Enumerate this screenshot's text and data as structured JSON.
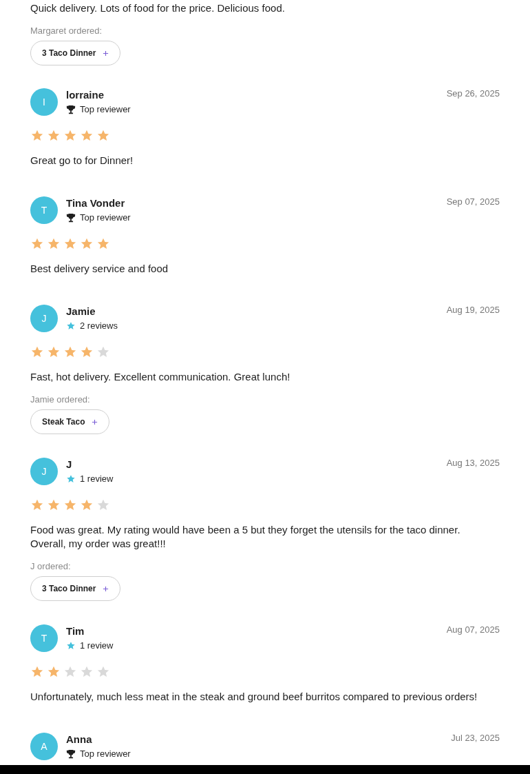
{
  "partial_review": {
    "text": "Quick delivery. Lots of food for the price. Delicious food.",
    "ordered_label": "Margaret ordered:",
    "order_items": [
      "3 Taco Dinner"
    ]
  },
  "reviews": [
    {
      "initial": "I",
      "name": "lorraine",
      "badge": {
        "kind": "top_reviewer",
        "text": "Top reviewer"
      },
      "date": "Sep 26, 2025",
      "stars": 5,
      "text": "Great go to for Dinner!"
    },
    {
      "initial": "T",
      "name": "Tina Vonder",
      "badge": {
        "kind": "top_reviewer",
        "text": "Top reviewer"
      },
      "date": "Sep 07, 2025",
      "stars": 5,
      "text": "Best delivery service and food"
    },
    {
      "initial": "J",
      "name": "Jamie",
      "badge": {
        "kind": "count",
        "text": "2 reviews"
      },
      "date": "Aug 19, 2025",
      "stars": 4,
      "text": "Fast, hot delivery. Excellent communication. Great lunch!",
      "ordered_label": "Jamie ordered:",
      "order_items": [
        "Steak Taco"
      ]
    },
    {
      "initial": "J",
      "name": "J",
      "badge": {
        "kind": "count",
        "text": "1 review"
      },
      "date": "Aug 13, 2025",
      "stars": 4,
      "text": "Food was great. My rating would have been a 5 but they forget the utensils for the taco dinner. Overall, my order was great!!!",
      "ordered_label": "J ordered:",
      "order_items": [
        "3 Taco Dinner"
      ]
    },
    {
      "initial": "T",
      "name": "Tim",
      "badge": {
        "kind": "count",
        "text": "1 review"
      },
      "date": "Aug 07, 2025",
      "stars": 2,
      "text": "Unfortunately, much less meat in the steak and ground beef burritos compared to previous orders!"
    },
    {
      "initial": "A",
      "name": "Anna",
      "badge": {
        "kind": "top_reviewer",
        "text": "Top reviewer"
      },
      "date": "Jul 23, 2025"
    }
  ]
}
